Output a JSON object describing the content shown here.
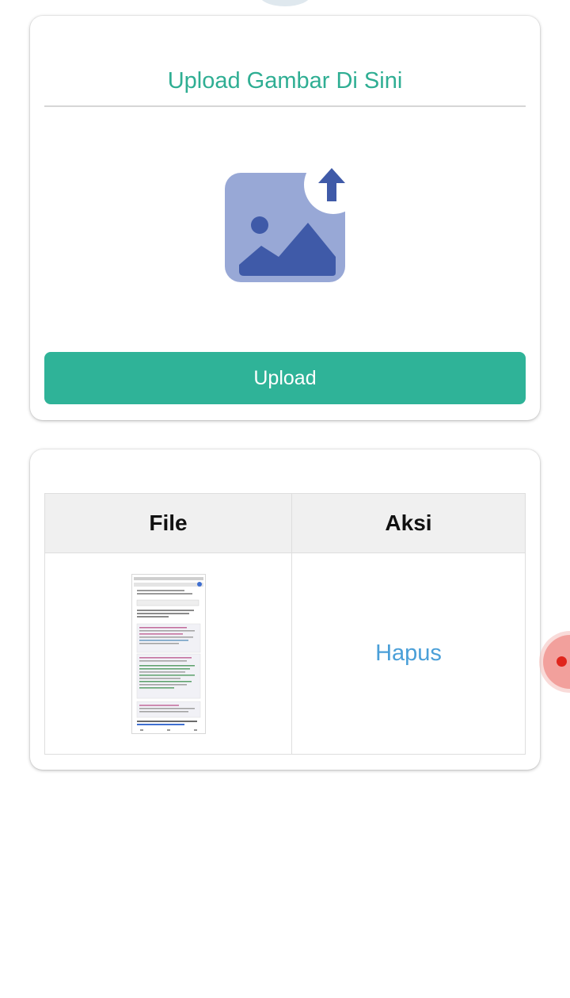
{
  "upload_card": {
    "title": "Upload Gambar Di Sini",
    "button_label": "Upload"
  },
  "file_table": {
    "headers": {
      "file": "File",
      "action": "Aksi"
    },
    "rows": [
      {
        "file_icon": "screenshot-thumbnail",
        "action_label": "Hapus"
      }
    ]
  },
  "colors": {
    "accent": "#2fb398",
    "title": "#2fae93",
    "link": "#4a9fd8",
    "icon_light": "#98a8d6",
    "icon_dark": "#3f5aa8",
    "record": "#e0251c"
  },
  "icons": {
    "upload_graphic": "image-upload-icon",
    "floating": "record-icon"
  }
}
